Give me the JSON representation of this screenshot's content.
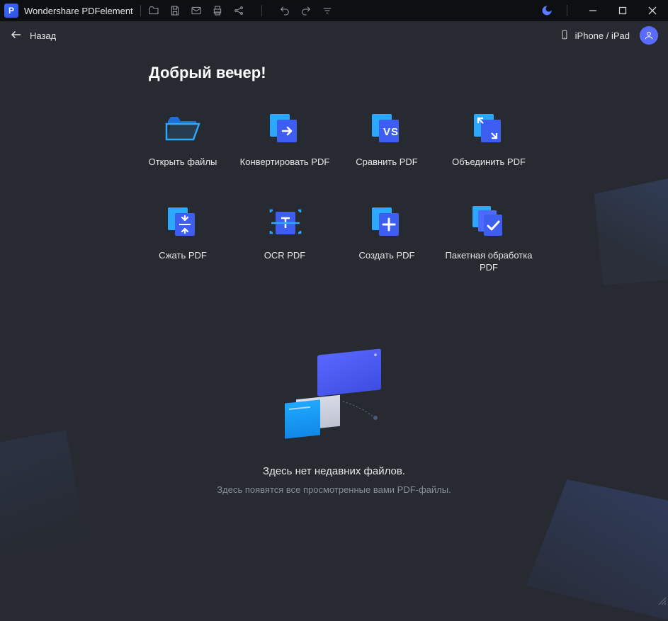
{
  "app": {
    "title": "Wondershare PDFelement"
  },
  "subbar": {
    "back_label": "Назад",
    "iphone_label": "iPhone / iPad"
  },
  "greeting": "Добрый вечер!",
  "tiles": [
    {
      "label": "Открыть файлы"
    },
    {
      "label": "Конвертировать PDF"
    },
    {
      "label": "Сравнить PDF"
    },
    {
      "label": "Объединить PDF"
    },
    {
      "label": "Сжать PDF"
    },
    {
      "label": "OCR PDF"
    },
    {
      "label": "Создать PDF"
    },
    {
      "label": "Пакетная обработка PDF"
    }
  ],
  "empty": {
    "title": "Здесь нет недавних файлов.",
    "subtitle": "Здесь появятся все просмотренные вами PDF-файлы."
  },
  "colors": {
    "accent": "#4d6aff",
    "accent_light": "#2aa9ff"
  }
}
